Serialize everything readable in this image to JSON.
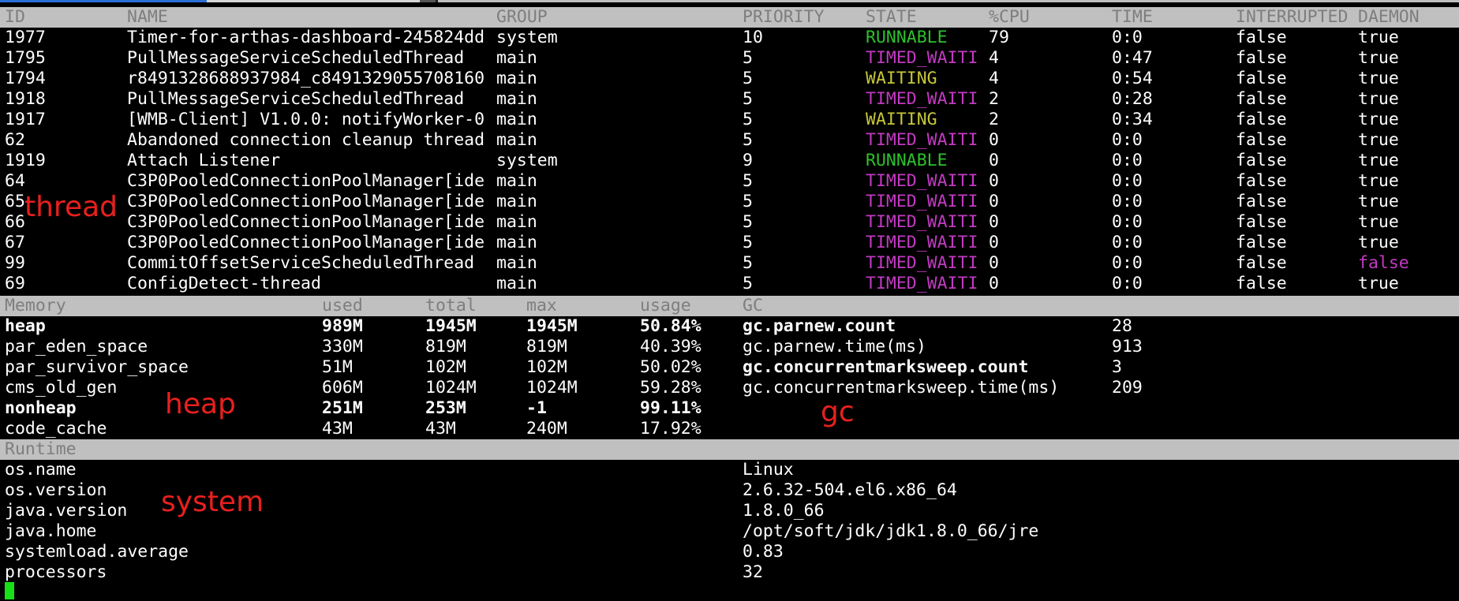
{
  "threads": {
    "headers": [
      "ID",
      "NAME",
      "GROUP",
      "PRIORITY",
      "STATE",
      "%CPU",
      "TIME",
      "INTERRUPTED",
      "DAEMON"
    ],
    "rows": [
      {
        "id": "1977",
        "name": "Timer-for-arthas-dashboard-245824dd",
        "group": "system",
        "priority": "10",
        "state": "RUNNABLE",
        "cpu": "79",
        "time": "0:0",
        "interrupted": "false",
        "daemon": "true"
      },
      {
        "id": "1795",
        "name": "PullMessageServiceScheduledThread",
        "group": "main",
        "priority": "5",
        "state": "TIMED_WAITI",
        "cpu": "4",
        "time": "0:47",
        "interrupted": "false",
        "daemon": "true"
      },
      {
        "id": "1794",
        "name": "r8491328688937984_c8491329055708160",
        "group": "main",
        "priority": "5",
        "state": "WAITING",
        "cpu": "4",
        "time": "0:54",
        "interrupted": "false",
        "daemon": "true"
      },
      {
        "id": "1918",
        "name": "PullMessageServiceScheduledThread",
        "group": "main",
        "priority": "5",
        "state": "TIMED_WAITI",
        "cpu": "2",
        "time": "0:28",
        "interrupted": "false",
        "daemon": "true"
      },
      {
        "id": "1917",
        "name": "[WMB-Client] V1.0.0: notifyWorker-0",
        "group": "main",
        "priority": "5",
        "state": "WAITING",
        "cpu": "2",
        "time": "0:34",
        "interrupted": "false",
        "daemon": "true"
      },
      {
        "id": "62",
        "name": "Abandoned connection cleanup thread",
        "group": "main",
        "priority": "5",
        "state": "TIMED_WAITI",
        "cpu": "0",
        "time": "0:0",
        "interrupted": "false",
        "daemon": "true"
      },
      {
        "id": "1919",
        "name": "Attach Listener",
        "group": "system",
        "priority": "9",
        "state": "RUNNABLE",
        "cpu": "0",
        "time": "0:0",
        "interrupted": "false",
        "daemon": "true"
      },
      {
        "id": "64",
        "name": "C3P0PooledConnectionPoolManager[ide",
        "group": "main",
        "priority": "5",
        "state": "TIMED_WAITI",
        "cpu": "0",
        "time": "0:0",
        "interrupted": "false",
        "daemon": "true"
      },
      {
        "id": "65",
        "name": "C3P0PooledConnectionPoolManager[ide",
        "group": "main",
        "priority": "5",
        "state": "TIMED_WAITI",
        "cpu": "0",
        "time": "0:0",
        "interrupted": "false",
        "daemon": "true"
      },
      {
        "id": "66",
        "name": "C3P0PooledConnectionPoolManager[ide",
        "group": "main",
        "priority": "5",
        "state": "TIMED_WAITI",
        "cpu": "0",
        "time": "0:0",
        "interrupted": "false",
        "daemon": "true"
      },
      {
        "id": "67",
        "name": "C3P0PooledConnectionPoolManager[ide",
        "group": "main",
        "priority": "5",
        "state": "TIMED_WAITI",
        "cpu": "0",
        "time": "0:0",
        "interrupted": "false",
        "daemon": "true"
      },
      {
        "id": "99",
        "name": "CommitOffsetServiceScheduledThread",
        "group": "main",
        "priority": "5",
        "state": "TIMED_WAITI",
        "cpu": "0",
        "time": "0:0",
        "interrupted": "false",
        "daemon": "false"
      },
      {
        "id": "69",
        "name": "ConfigDetect-thread",
        "group": "main",
        "priority": "5",
        "state": "TIMED_WAITI",
        "cpu": "0",
        "time": "0:0",
        "interrupted": "false",
        "daemon": "true"
      }
    ]
  },
  "memory": {
    "headers": [
      "Memory",
      "used",
      "total",
      "max",
      "usage"
    ],
    "rows": [
      {
        "name": "heap",
        "used": "989M",
        "total": "1945M",
        "max": "1945M",
        "usage": "50.84%",
        "bold": true
      },
      {
        "name": "par_eden_space",
        "used": "330M",
        "total": "819M",
        "max": "819M",
        "usage": "40.39%",
        "bold": false
      },
      {
        "name": "par_survivor_space",
        "used": "51M",
        "total": "102M",
        "max": "102M",
        "usage": "50.02%",
        "bold": false
      },
      {
        "name": "cms_old_gen",
        "used": "606M",
        "total": "1024M",
        "max": "1024M",
        "usage": "59.28%",
        "bold": false
      },
      {
        "name": "nonheap",
        "used": "251M",
        "total": "253M",
        "max": "-1",
        "usage": "99.11%",
        "bold": true
      },
      {
        "name": "code_cache",
        "used": "43M",
        "total": "43M",
        "max": "240M",
        "usage": "17.92%",
        "bold": false
      }
    ]
  },
  "gc": {
    "header": "GC",
    "rows": [
      {
        "name": "gc.parnew.count",
        "value": "28",
        "bold": true
      },
      {
        "name": "gc.parnew.time(ms)",
        "value": "913",
        "bold": false
      },
      {
        "name": "gc.concurrentmarksweep.count",
        "value": "3",
        "bold": true
      },
      {
        "name": "gc.concurrentmarksweep.time(ms)",
        "value": "209",
        "bold": false
      }
    ]
  },
  "runtime": {
    "header": "Runtime",
    "rows": [
      {
        "name": "os.name",
        "value": "Linux"
      },
      {
        "name": "os.version",
        "value": "2.6.32-504.el6.x86_64"
      },
      {
        "name": "java.version",
        "value": "1.8.0_66"
      },
      {
        "name": "java.home",
        "value": "/opt/soft/jdk/jdk1.8.0_66/jre"
      },
      {
        "name": "systemload.average",
        "value": "0.83"
      },
      {
        "name": "processors",
        "value": "32"
      }
    ]
  },
  "annotations": {
    "thread": "thread",
    "heap": "heap",
    "gc": "gc",
    "system": "system"
  },
  "colors": {
    "runnable": "#2cc12c",
    "timed_waiting": "#c23ac2",
    "waiting": "#c6c63a",
    "daemon_false": "#c23ac2",
    "annotation": "#e8201e",
    "header_bg": "#c0c0c0",
    "cursor": "#18e018"
  }
}
